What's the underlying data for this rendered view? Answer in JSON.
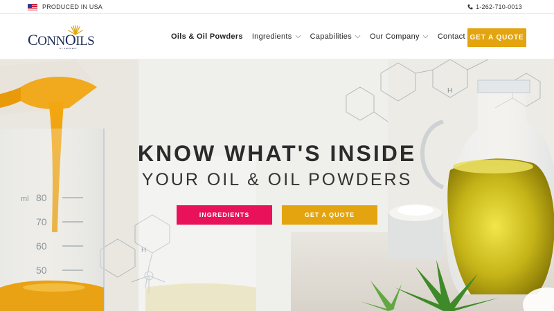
{
  "topbar": {
    "made_in": "PRODUCED IN USA",
    "phone": "1-262-710-0013"
  },
  "logo": {
    "name_cap1": "C",
    "name_rest1": "ONN",
    "name_cap2": "O",
    "name_rest2": "ILS",
    "tagline": "BY SENSIENT"
  },
  "nav": {
    "items": [
      {
        "label": "Oils & Oil Powders"
      },
      {
        "label": "Ingredients"
      },
      {
        "label": "Capabilities"
      },
      {
        "label": "Our Company"
      },
      {
        "label": "Contact"
      }
    ],
    "cta": "GET A QUOTE"
  },
  "hero": {
    "title": "KNOW WHAT'S INSIDE",
    "subtitle": "YOUR OIL & OIL POWDERS",
    "btn_primary": "INGREDIENTS",
    "btn_secondary": "GET A QUOTE",
    "beaker_marks": [
      "80",
      "70",
      "60",
      "50"
    ],
    "beaker_unit": "ml",
    "molecule_letter": "H"
  },
  "colors": {
    "accent_gold": "#e3a40f",
    "accent_pink": "#e8115a",
    "brand_navy": "#1c2b57"
  }
}
